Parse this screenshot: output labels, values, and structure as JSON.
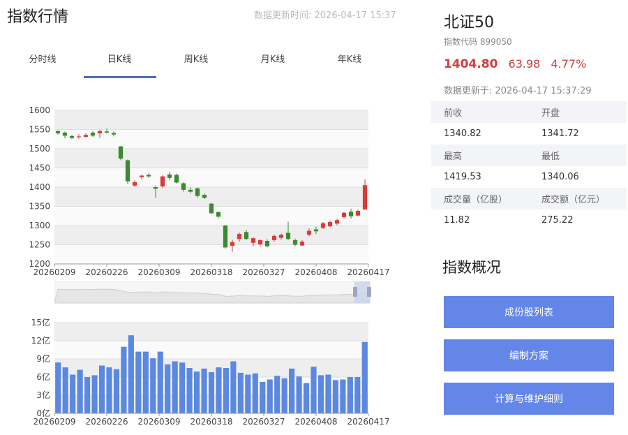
{
  "page": {
    "title": "指数行情",
    "update_label": "数据更新时间: 2026-04-17 15:37"
  },
  "tabs": [
    {
      "label": "分时线"
    },
    {
      "label": "日K线"
    },
    {
      "label": "周K线"
    },
    {
      "label": "月K线"
    },
    {
      "label": "年K线"
    }
  ],
  "active_tab": "日K线",
  "index_info": {
    "name": "北证50",
    "code_label": "指数代码 899050",
    "price": "1404.80",
    "change": "63.98",
    "change_pct": "4.77%",
    "data_time": "数据更新于: 2026-04-17 15:37:29"
  },
  "stats": [
    {
      "label": "前收",
      "value": "1340.82"
    },
    {
      "label": "开盘",
      "value": "1341.72"
    },
    {
      "label": "最高",
      "value": "1419.53"
    },
    {
      "label": "最低",
      "value": "1340.06"
    },
    {
      "label": "成交量（亿股）",
      "value": "11.82"
    },
    {
      "label": "成交额（亿元）",
      "value": "275.22"
    }
  ],
  "overview": {
    "title": "指数概况",
    "buttons": [
      "成份股列表",
      "编制方案",
      "计算与维护细则"
    ]
  },
  "colors": {
    "up": "#d93a3a",
    "down": "#3a8a2e",
    "volume_bar": "#5b88e0",
    "accent": "#6386e8",
    "price_text": "#d43c3c"
  },
  "chart_data": [
    {
      "type": "candlestick",
      "title": "",
      "ylim": [
        1200,
        1600
      ],
      "y_ticks": [
        "1600",
        "1550",
        "1500",
        "1450",
        "1400",
        "1350",
        "1300",
        "1250",
        "1200"
      ],
      "x_tick_labels": [
        "20260209",
        "20260226",
        "20260309",
        "20260318",
        "20260327",
        "20260408",
        "20260417"
      ],
      "candles": [
        {
          "o": 1546,
          "c": 1540,
          "h": 1548,
          "l": 1537
        },
        {
          "o": 1542,
          "c": 1534,
          "h": 1545,
          "l": 1527
        },
        {
          "o": 1533,
          "c": 1528,
          "h": 1536,
          "l": 1525
        },
        {
          "o": 1530,
          "c": 1532,
          "h": 1538,
          "l": 1526
        },
        {
          "o": 1531,
          "c": 1536,
          "h": 1540,
          "l": 1528
        },
        {
          "o": 1542,
          "c": 1534,
          "h": 1546,
          "l": 1531
        },
        {
          "o": 1540,
          "c": 1546,
          "h": 1549,
          "l": 1528
        },
        {
          "o": 1545,
          "c": 1542,
          "h": 1552,
          "l": 1540
        },
        {
          "o": 1541,
          "c": 1537,
          "h": 1545,
          "l": 1532
        },
        {
          "o": 1506,
          "c": 1474,
          "h": 1507,
          "l": 1470
        },
        {
          "o": 1470,
          "c": 1415,
          "h": 1472,
          "l": 1408
        },
        {
          "o": 1404,
          "c": 1413,
          "h": 1418,
          "l": 1400
        },
        {
          "o": 1426,
          "c": 1430,
          "h": 1433,
          "l": 1420
        },
        {
          "o": 1432,
          "c": 1428,
          "h": 1436,
          "l": 1424
        },
        {
          "o": 1400,
          "c": 1396,
          "h": 1404,
          "l": 1372
        },
        {
          "o": 1402,
          "c": 1428,
          "h": 1431,
          "l": 1398
        },
        {
          "o": 1433,
          "c": 1424,
          "h": 1440,
          "l": 1418
        },
        {
          "o": 1432,
          "c": 1412,
          "h": 1435,
          "l": 1409
        },
        {
          "o": 1410,
          "c": 1393,
          "h": 1413,
          "l": 1388
        },
        {
          "o": 1393,
          "c": 1388,
          "h": 1399,
          "l": 1384
        },
        {
          "o": 1397,
          "c": 1377,
          "h": 1399,
          "l": 1373
        },
        {
          "o": 1380,
          "c": 1372,
          "h": 1384,
          "l": 1369
        },
        {
          "o": 1357,
          "c": 1332,
          "h": 1359,
          "l": 1330
        },
        {
          "o": 1335,
          "c": 1323,
          "h": 1337,
          "l": 1318
        },
        {
          "o": 1300,
          "c": 1243,
          "h": 1302,
          "l": 1240
        },
        {
          "o": 1247,
          "c": 1257,
          "h": 1263,
          "l": 1232
        },
        {
          "o": 1265,
          "c": 1278,
          "h": 1282,
          "l": 1258
        },
        {
          "o": 1283,
          "c": 1265,
          "h": 1289,
          "l": 1262
        },
        {
          "o": 1255,
          "c": 1267,
          "h": 1270,
          "l": 1246
        },
        {
          "o": 1251,
          "c": 1262,
          "h": 1264,
          "l": 1246
        },
        {
          "o": 1260,
          "c": 1246,
          "h": 1264,
          "l": 1243
        },
        {
          "o": 1262,
          "c": 1273,
          "h": 1276,
          "l": 1258
        },
        {
          "o": 1268,
          "c": 1276,
          "h": 1279,
          "l": 1263
        },
        {
          "o": 1281,
          "c": 1265,
          "h": 1310,
          "l": 1262
        },
        {
          "o": 1262,
          "c": 1250,
          "h": 1266,
          "l": 1246
        },
        {
          "o": 1248,
          "c": 1258,
          "h": 1262,
          "l": 1247
        },
        {
          "o": 1276,
          "c": 1286,
          "h": 1292,
          "l": 1272
        },
        {
          "o": 1290,
          "c": 1285,
          "h": 1297,
          "l": 1278
        },
        {
          "o": 1294,
          "c": 1306,
          "h": 1309,
          "l": 1291
        },
        {
          "o": 1298,
          "c": 1309,
          "h": 1313,
          "l": 1296
        },
        {
          "o": 1305,
          "c": 1314,
          "h": 1318,
          "l": 1301
        },
        {
          "o": 1322,
          "c": 1333,
          "h": 1336,
          "l": 1318
        },
        {
          "o": 1336,
          "c": 1324,
          "h": 1344,
          "l": 1318
        },
        {
          "o": 1326,
          "c": 1338,
          "h": 1342,
          "l": 1324
        },
        {
          "o": 1342,
          "c": 1405,
          "h": 1420,
          "l": 1340
        }
      ]
    },
    {
      "type": "bar",
      "title": "",
      "ylim": [
        0,
        15
      ],
      "y_ticks": [
        "15亿",
        "12亿",
        "9亿",
        "6亿",
        "3亿",
        "0亿"
      ],
      "x_tick_labels": [
        "20260209",
        "20260226",
        "20260309",
        "20260318",
        "20260327",
        "20260408",
        "20260417"
      ],
      "values": [
        8.4,
        7.6,
        6.4,
        7.2,
        6.0,
        6.3,
        7.9,
        7.6,
        7.3,
        11.0,
        12.9,
        10.2,
        10.2,
        9.1,
        10.2,
        8.1,
        8.6,
        8.4,
        7.5,
        6.9,
        7.4,
        6.8,
        7.6,
        7.5,
        8.6,
        6.7,
        6.4,
        6.6,
        5.2,
        5.6,
        6.2,
        5.8,
        7.4,
        6.1,
        5.0,
        7.7,
        6.3,
        6.4,
        5.5,
        5.6,
        6.0,
        6.0,
        11.8
      ]
    }
  ]
}
